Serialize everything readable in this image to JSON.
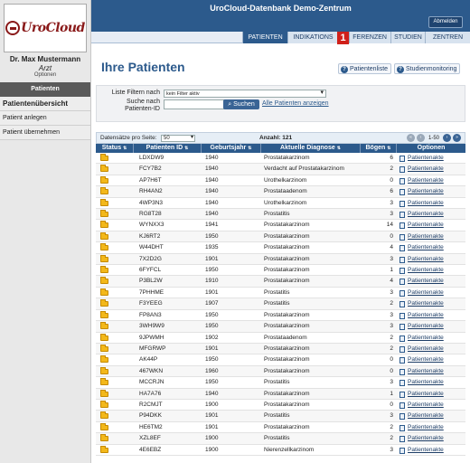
{
  "app": {
    "title": "UroCloud-Datenbank Demo-Zentrum",
    "logout_label": "Abmelden",
    "logo_text": "UroCloud"
  },
  "user": {
    "name": "Dr. Max Mustermann",
    "role": "Arzt",
    "options_label": "Optionen"
  },
  "sidebar": {
    "active_label": "Patienten",
    "items": [
      "Patientenübersicht",
      "Patient anlegen",
      "Patient übernehmen"
    ]
  },
  "navtabs": [
    "PATIENTEN",
    "INDIKATIONS",
    "FERENZEN",
    "STUDIEN",
    "ZENTREN"
  ],
  "badge": "1",
  "page": {
    "title": "Ihre Patienten",
    "btn_patientenliste": "Patientenliste",
    "btn_studienmonitoring": "Studienmonitoring"
  },
  "filter": {
    "label_filter": "Liste Filtern nach",
    "filter_value": "kein Filter aktiv",
    "label_search_1": "Suche nach",
    "label_search_2": "Patienten-ID",
    "search_value": "",
    "search_button": "Suchen",
    "show_all_link": "Alle Patienten anzeigen"
  },
  "table_bar": {
    "per_page_label": "Datensätze pro Seite:",
    "per_page_value": "50",
    "count_label": "Anzahl: 121",
    "range_label": "1-50"
  },
  "columns": [
    "Status",
    "Patienten ID",
    "Geburtsjahr",
    "Aktuelle Diagnose",
    "Bögen",
    "Optionen"
  ],
  "akte_label": "Patientenakte",
  "rows": [
    {
      "id": "LDXDW9",
      "year": "1940",
      "diag": "Prostatakarzinom",
      "boegen": "6"
    },
    {
      "id": "FCY7B2",
      "year": "1940",
      "diag": "Verdacht auf Prostatakarzinom",
      "boegen": "2"
    },
    {
      "id": "AP7H6T",
      "year": "1940",
      "diag": "Urothelkarzinom",
      "boegen": "0"
    },
    {
      "id": "RH4AN2",
      "year": "1940",
      "diag": "Prostataadenom",
      "boegen": "6"
    },
    {
      "id": "4WP3N3",
      "year": "1940",
      "diag": "Urothelkarzinom",
      "boegen": "3"
    },
    {
      "id": "RG8T28",
      "year": "1940",
      "diag": "Prostatitis",
      "boegen": "3"
    },
    {
      "id": "WYNXX3",
      "year": "1941",
      "diag": "Prostatakarzinom",
      "boegen": "14"
    },
    {
      "id": "KJ6RT2",
      "year": "1950",
      "diag": "Prostatakarzinom",
      "boegen": "0"
    },
    {
      "id": "W44DHT",
      "year": "1935",
      "diag": "Prostatakarzinom",
      "boegen": "4"
    },
    {
      "id": "7X2D2G",
      "year": "1901",
      "diag": "Prostatakarzinom",
      "boegen": "3"
    },
    {
      "id": "6FYFCL",
      "year": "1950",
      "diag": "Prostatakarzinom",
      "boegen": "1"
    },
    {
      "id": "P3BL2W",
      "year": "1910",
      "diag": "Prostatakarzinom",
      "boegen": "4"
    },
    {
      "id": "7PHHME",
      "year": "1901",
      "diag": "Prostatitis",
      "boegen": "3"
    },
    {
      "id": "F3YEEG",
      "year": "1907",
      "diag": "Prostatitis",
      "boegen": "2"
    },
    {
      "id": "FP8AN3",
      "year": "1950",
      "diag": "Prostatakarzinom",
      "boegen": "3"
    },
    {
      "id": "3WH9W9",
      "year": "1950",
      "diag": "Prostatakarzinom",
      "boegen": "3"
    },
    {
      "id": "9JPWMH",
      "year": "1902",
      "diag": "Prostataadenom",
      "boegen": "2"
    },
    {
      "id": "MFGRWP",
      "year": "1901",
      "diag": "Prostatakarzinom",
      "boegen": "2"
    },
    {
      "id": "AK44P",
      "year": "1950",
      "diag": "Prostatakarzinom",
      "boegen": "0"
    },
    {
      "id": "467WKN",
      "year": "1960",
      "diag": "Prostatakarzinom",
      "boegen": "0"
    },
    {
      "id": "MCCRJN",
      "year": "1950",
      "diag": "Prostatitis",
      "boegen": "3"
    },
    {
      "id": "HA7A76",
      "year": "1940",
      "diag": "Prostatakarzinom",
      "boegen": "1"
    },
    {
      "id": "R2CMJT",
      "year": "1900",
      "diag": "Prostatakarzinom",
      "boegen": "0"
    },
    {
      "id": "P94DKK",
      "year": "1901",
      "diag": "Prostatitis",
      "boegen": "3"
    },
    {
      "id": "HE6TM2",
      "year": "1901",
      "diag": "Prostatakarzinom",
      "boegen": "2"
    },
    {
      "id": "XZL8EF",
      "year": "1900",
      "diag": "Prostatitis",
      "boegen": "2"
    },
    {
      "id": "4E6EBZ",
      "year": "1900",
      "diag": "Nierenzellkarzinom",
      "boegen": "3"
    }
  ]
}
